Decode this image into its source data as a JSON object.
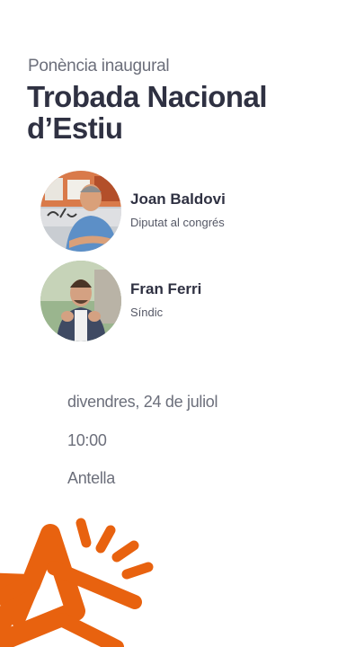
{
  "event": {
    "subtitle": "Ponència inaugural",
    "title": "Trobada Nacional d’Estiu"
  },
  "speakers": [
    {
      "name": "Joan Baldovi",
      "role": "Diputat al congrés"
    },
    {
      "name": "Fran Ferri",
      "role": "Síndic"
    }
  ],
  "details": {
    "date": "divendres, 24 de juliol",
    "time": "10:00",
    "place": "Antella"
  },
  "colors": {
    "brand_orange": "#e8620f",
    "title_text": "#2f3142",
    "muted_text": "#6c6f7b"
  },
  "icons": [
    "star-burst-logo"
  ]
}
